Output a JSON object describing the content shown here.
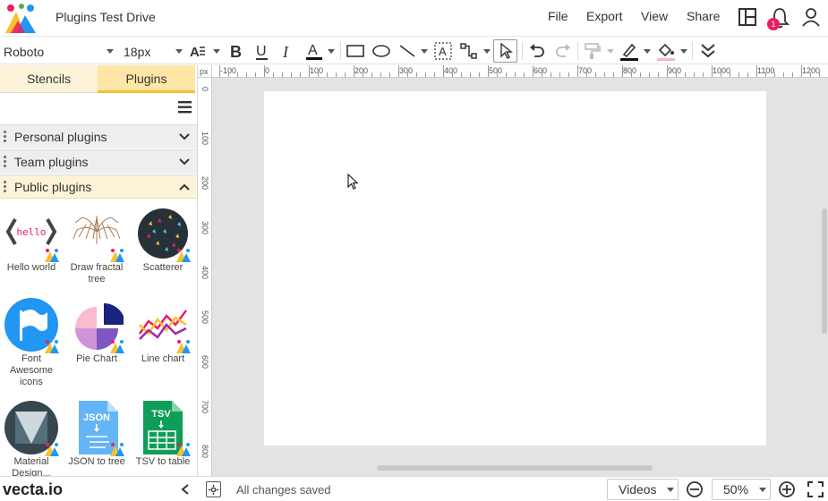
{
  "header": {
    "title": "Plugins Test Drive",
    "menu": [
      "File",
      "Export",
      "View",
      "Share"
    ],
    "notification_count": "1"
  },
  "toolbar": {
    "font_family": "Roboto",
    "font_size": "18px"
  },
  "left_panel": {
    "tabs": [
      "Stencils",
      "Plugins"
    ],
    "active_tab": "Plugins",
    "sections": [
      {
        "label": "Personal plugins",
        "expanded": false
      },
      {
        "label": "Team plugins",
        "expanded": false
      },
      {
        "label": "Public plugins",
        "expanded": true
      }
    ],
    "plugins": [
      {
        "label": "Hello world",
        "icon": "hello-icon",
        "thumb_text": "hello"
      },
      {
        "label": "Draw fractal tree",
        "icon": "fractal-tree-icon"
      },
      {
        "label": "Scatterer",
        "icon": "scatterer-icon"
      },
      {
        "label": "Font Awesome icons",
        "icon": "flag-icon"
      },
      {
        "label": "Pie Chart",
        "icon": "pie-chart-icon"
      },
      {
        "label": "Line chart",
        "icon": "line-chart-icon"
      },
      {
        "label": "Material Design...",
        "icon": "material-icon"
      },
      {
        "label": "JSON to tree",
        "icon": "json-file-icon",
        "thumb_text": "JSON"
      },
      {
        "label": "TSV to table",
        "icon": "tsv-file-icon",
        "thumb_text": "TSV"
      }
    ]
  },
  "rulers": {
    "unit": "px",
    "horizontal": [
      "-100",
      "0",
      "100",
      "200",
      "300",
      "400",
      "500",
      "600",
      "700",
      "800",
      "900",
      "1000",
      "1100",
      "1200"
    ],
    "vertical": [
      "0",
      "100",
      "200",
      "300",
      "400",
      "500",
      "600",
      "700",
      "800"
    ]
  },
  "statusbar": {
    "brand": "vecta.io",
    "status": "All changes saved",
    "videos_label": "Videos",
    "zoom": "50%"
  },
  "colors": {
    "accent": "#f2c233",
    "tab_active_bg": "#fde6a6",
    "tab_bg": "#fdf3d8",
    "badge": "#e91e63"
  }
}
